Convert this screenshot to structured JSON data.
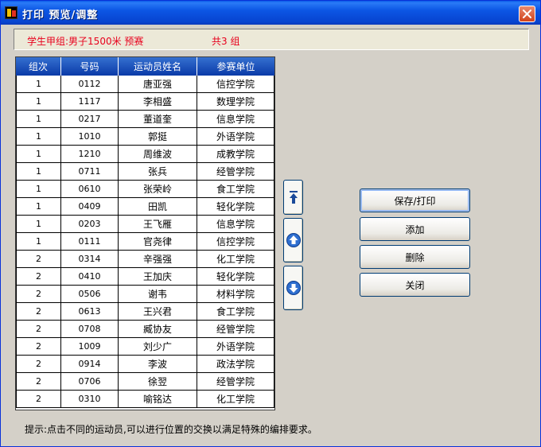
{
  "window": {
    "title": "打印 预览/调整"
  },
  "info": {
    "group": "学生甲组:男子1500米 预赛",
    "count": "共3 组"
  },
  "table": {
    "headers": [
      "组次",
      "号码",
      "运动员姓名",
      "参赛单位"
    ],
    "rows": [
      [
        "1",
        "0112",
        "唐亚强",
        "信控学院"
      ],
      [
        "1",
        "1117",
        "李相盛",
        "数理学院"
      ],
      [
        "1",
        "0217",
        "董道奎",
        "信息学院"
      ],
      [
        "1",
        "1010",
        "郭挺",
        "外语学院"
      ],
      [
        "1",
        "1210",
        "周维波",
        "成教学院"
      ],
      [
        "1",
        "0711",
        "张兵",
        "经管学院"
      ],
      [
        "1",
        "0610",
        "张荣岭",
        "食工学院"
      ],
      [
        "1",
        "0409",
        "田凯",
        "轻化学院"
      ],
      [
        "1",
        "0203",
        "王飞雁",
        "信息学院"
      ],
      [
        "1",
        "0111",
        "官尧律",
        "信控学院"
      ],
      [
        "2",
        "0314",
        "辛强强",
        "化工学院"
      ],
      [
        "2",
        "0410",
        "王加庆",
        "轻化学院"
      ],
      [
        "2",
        "0506",
        "谢韦",
        "材料学院"
      ],
      [
        "2",
        "0613",
        "王兴君",
        "食工学院"
      ],
      [
        "2",
        "0708",
        "臧协友",
        "经管学院"
      ],
      [
        "2",
        "1009",
        "刘少广",
        "外语学院"
      ],
      [
        "2",
        "0914",
        "李波",
        "政法学院"
      ],
      [
        "2",
        "0706",
        "徐翌",
        "经管学院"
      ],
      [
        "2",
        "0310",
        "喻铭达",
        "化工学院"
      ]
    ]
  },
  "nav": {
    "top_icon": "arrow-to-top-icon",
    "up_icon": "arrow-up-circle-icon",
    "down_icon": "arrow-down-circle-icon"
  },
  "actions": {
    "save_print": "保存/打印",
    "add": "添加",
    "delete": "删除",
    "close": "关闭"
  },
  "hint": "提示:点击不同的运动员,可以进行位置的交换以满足特殊的编排要求。",
  "colors": {
    "accent_red": "#e8001c",
    "titlebar_blue": "#0743cf",
    "header_blue": "#0a3aa8"
  }
}
